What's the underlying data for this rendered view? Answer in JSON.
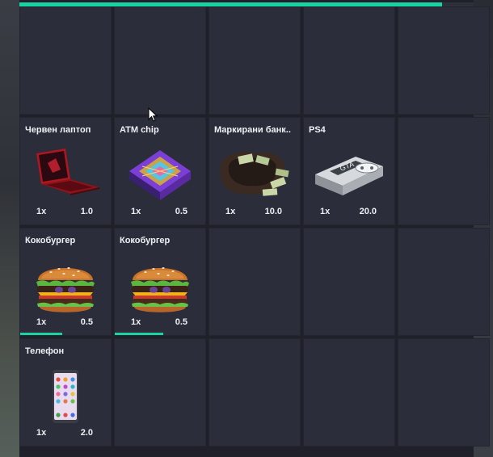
{
  "inventory": {
    "weight_progress": 0.93,
    "slots": [
      {
        "empty": true
      },
      {
        "empty": true
      },
      {
        "empty": true
      },
      {
        "empty": true
      },
      {
        "empty": true
      },
      {
        "name": "Червен лаптоп",
        "qty": "1x",
        "weight": "1.0",
        "icon": "laptop-icon"
      },
      {
        "name": "ATM chip",
        "qty": "1x",
        "weight": "0.5",
        "icon": "chip-icon"
      },
      {
        "name": "Маркирани банк..",
        "qty": "1x",
        "weight": "10.0",
        "icon": "money-bag-icon"
      },
      {
        "name": "PS4",
        "qty": "1x",
        "weight": "20.0",
        "icon": "console-icon"
      },
      {
        "empty": true
      },
      {
        "name": "Кокобургер",
        "qty": "1x",
        "weight": "0.5",
        "icon": "burger-icon",
        "durability": 0.46
      },
      {
        "name": "Кокобургер",
        "qty": "1x",
        "weight": "0.5",
        "icon": "burger-icon",
        "durability": 0.54
      },
      {
        "empty": true
      },
      {
        "empty": true
      },
      {
        "empty": true
      },
      {
        "name": "Телефон",
        "qty": "1x",
        "weight": "2.0",
        "icon": "phone-icon"
      },
      {
        "empty": true
      },
      {
        "empty": true
      },
      {
        "empty": true
      },
      {
        "empty": true
      }
    ]
  },
  "colors": {
    "accent": "#18d3a3",
    "slot_bg": "#2b2d3a",
    "panel_bg": "#1f2029"
  }
}
